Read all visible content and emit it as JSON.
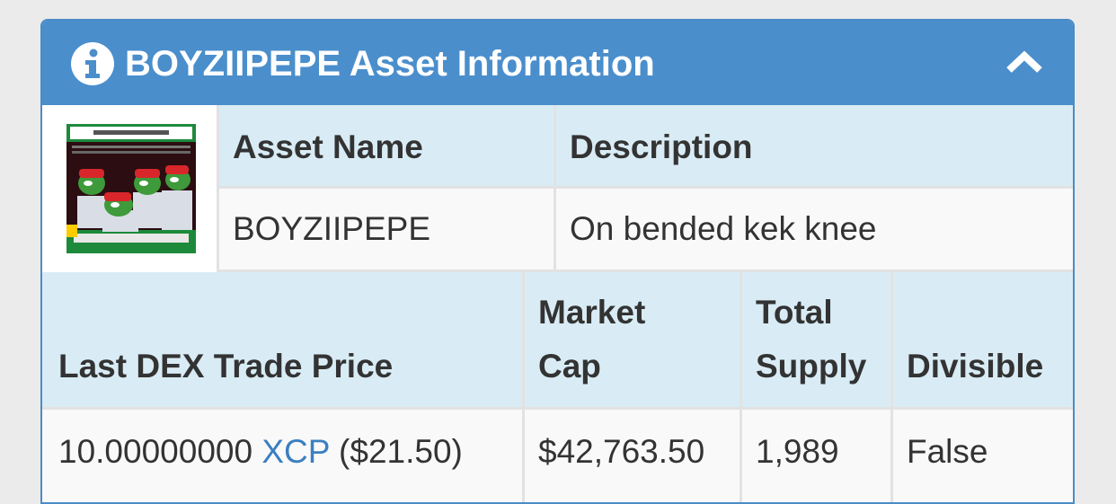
{
  "panel": {
    "title": "BOYZIIPEPE Asset Information",
    "info_icon": "info-circle-icon",
    "collapse_icon": "chevron-up-icon",
    "header_color": "#4a8ecc"
  },
  "asset": {
    "image_icon": "asset-image",
    "headers": {
      "name": "Asset Name",
      "description": "Description"
    },
    "name": "BOYZIIPEPE",
    "description": "On bended kek knee"
  },
  "market": {
    "headers": {
      "last_price": "Last DEX Trade Price",
      "market_cap_line1": "Market",
      "market_cap_line2": "Cap",
      "supply_line1": "Total",
      "supply_line2": "Supply",
      "divisible": "Divisible"
    },
    "last_price_amount": "10.00000000",
    "last_price_unit": "XCP",
    "last_price_usd": "($21.50)",
    "market_cap": "$42,763.50",
    "total_supply": "1,989",
    "divisible": "False"
  }
}
